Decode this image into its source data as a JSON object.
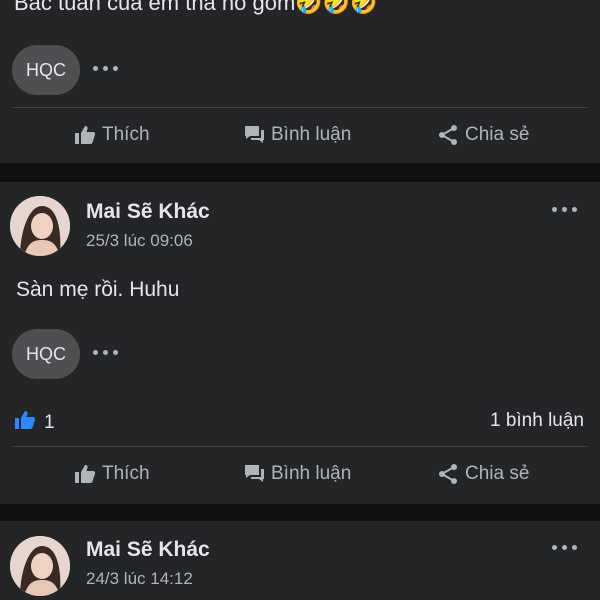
{
  "post1": {
    "text": "Bác tuấn của em thả hố gõm🤣🤣🤣",
    "commenter_chip": "HQC",
    "actions": {
      "like": "Thích",
      "comment": "Bình luận",
      "share": "Chia sẻ"
    }
  },
  "post2": {
    "author": "Mai Sẽ Khác",
    "time": "25/3 lúc 09:06",
    "text": "Sàn mẹ rồi. Huhu",
    "commenter_chip": "HQC",
    "like_count": "1",
    "comment_count": "1 bình luận",
    "actions": {
      "like": "Thích",
      "comment": "Bình luận",
      "share": "Chia sẻ"
    }
  },
  "post3": {
    "author": "Mai Sẽ Khác",
    "time": "24/3 lúc 14:12"
  },
  "colors": {
    "background": "#101010",
    "card": "#242526",
    "text": "#e4e6eb",
    "secondary": "#b0b3b8",
    "like_blue": "#2d88ff"
  }
}
